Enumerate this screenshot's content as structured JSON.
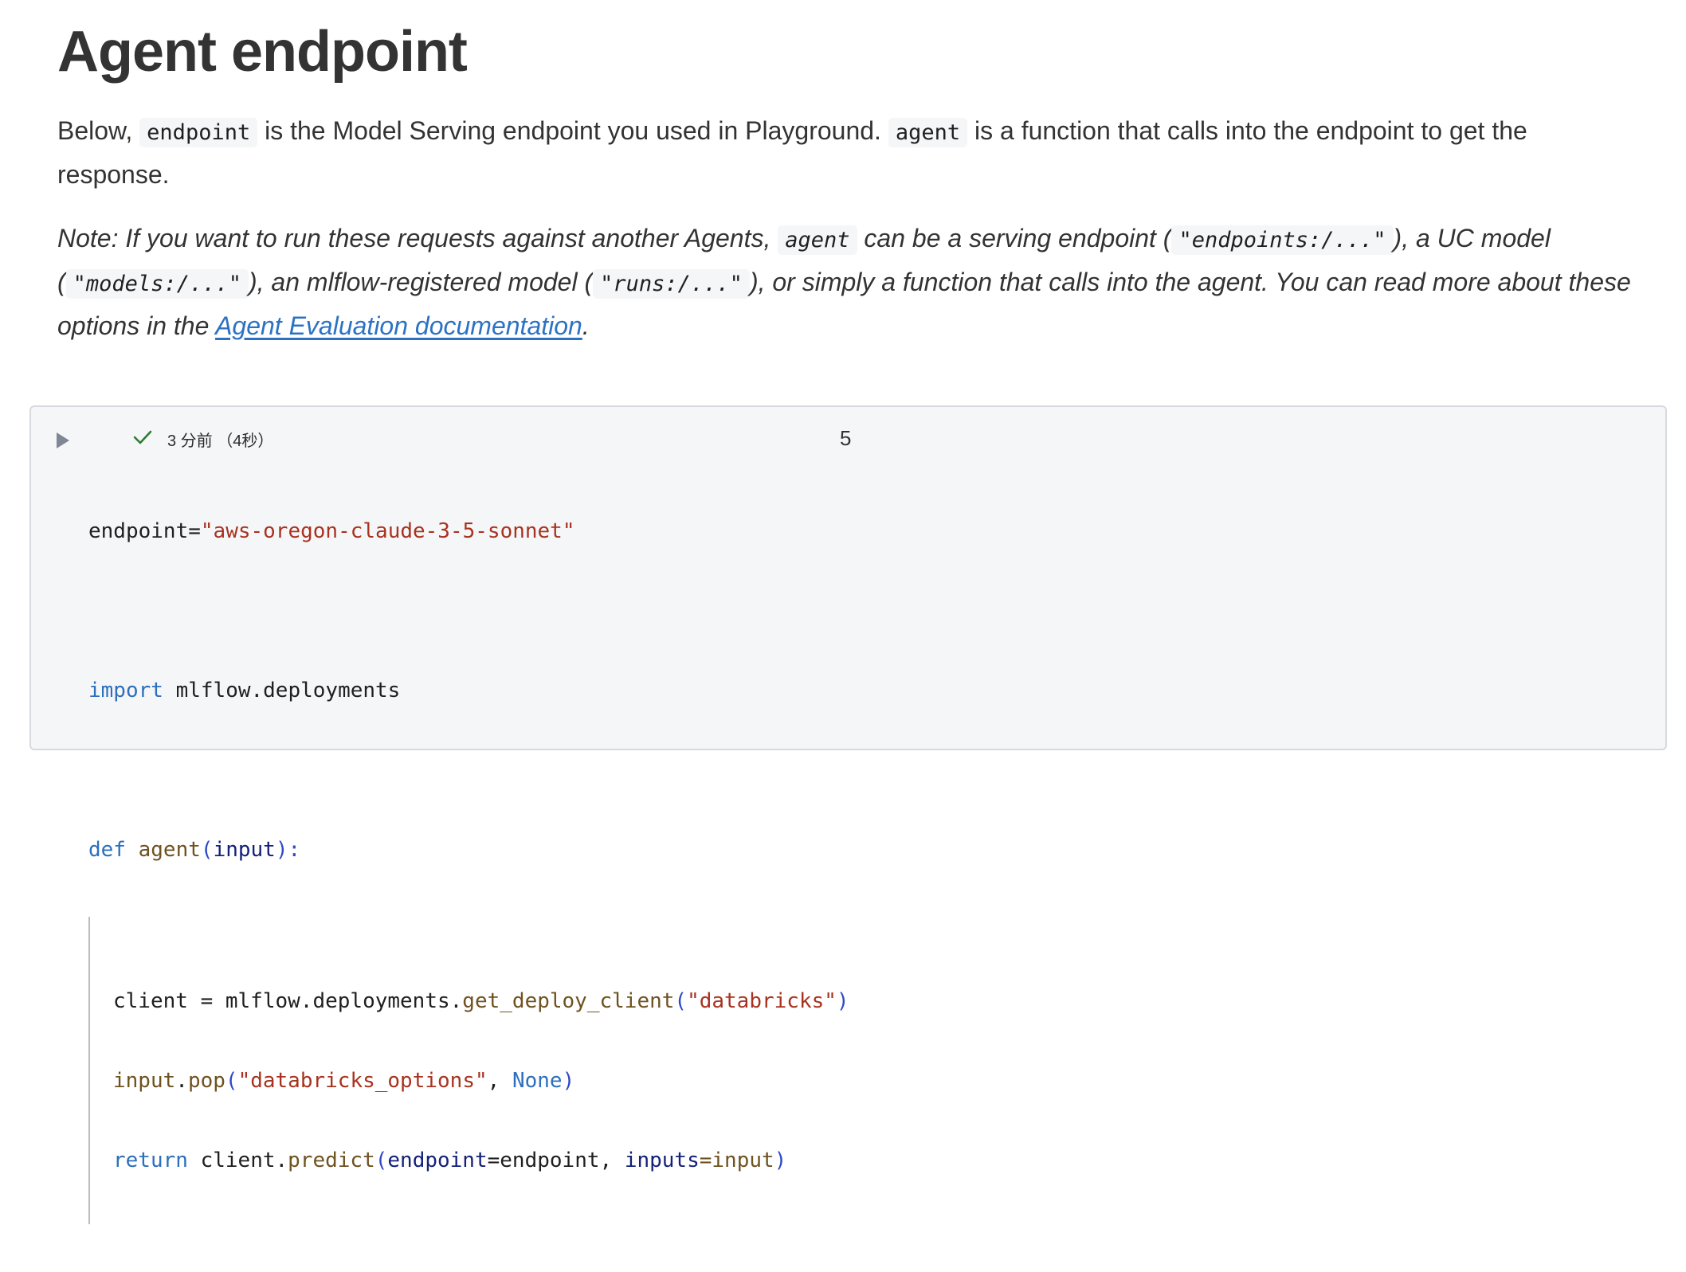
{
  "markdown": {
    "title": "Agent endpoint",
    "para1": {
      "t1": "Below, ",
      "c1": "endpoint",
      "t2": " is the Model Serving endpoint you used in Playground. ",
      "c2": "agent",
      "t3": " is a function that calls into the endpoint to get the response."
    },
    "para2": {
      "t1": "Note: If you want to run these requests against another Agents, ",
      "c1": "agent",
      "t2": " can be a serving endpoint (",
      "c2": "\"endpoints:/...\"",
      "t3": "), a UC model (",
      "c3": "\"models:/...\"",
      "t4": "), an mlflow-registered model (",
      "c4": "\"runs:/...\"",
      "t5": "), or simply a function that calls into the agent. You can read more about these options in the ",
      "link": "Agent Evaluation documentation",
      "t6": "."
    }
  },
  "cell": {
    "status": "3 分前 （4秒）",
    "number": "5",
    "icons": {
      "run": "play-icon",
      "status": "check-icon"
    },
    "colors": {
      "keyword": "#2c6fbd",
      "string": "#a8321f",
      "function": "#6e5220",
      "param": "#14207a",
      "success": "#2e7d32"
    },
    "code": {
      "l1": {
        "a": "endpoint=",
        "b": "\"aws-oregon-claude-3-5-sonnet\""
      },
      "l3": {
        "a": "import",
        "b": " mlflow.deployments"
      },
      "l5": {
        "a": "def",
        "b": " ",
        "c": "agent",
        "d": "(",
        "e": "input",
        "f": "):"
      },
      "l6": {
        "a": "client = mlflow.deployments.",
        "b": "get_deploy_client",
        "c": "(",
        "d": "\"databricks\"",
        "e": ")"
      },
      "l7": {
        "a": "input",
        "b": ".",
        "c": "pop",
        "d": "(",
        "e": "\"databricks_options\"",
        "f": ", ",
        "g": "None",
        "h": ")"
      },
      "l8": {
        "a": "return",
        "b": " client.",
        "c": "predict",
        "d": "(",
        "e": "endpoint",
        "f": "=endpoint, ",
        "g": "inputs",
        "h": "=input",
        "i": ")"
      }
    }
  }
}
